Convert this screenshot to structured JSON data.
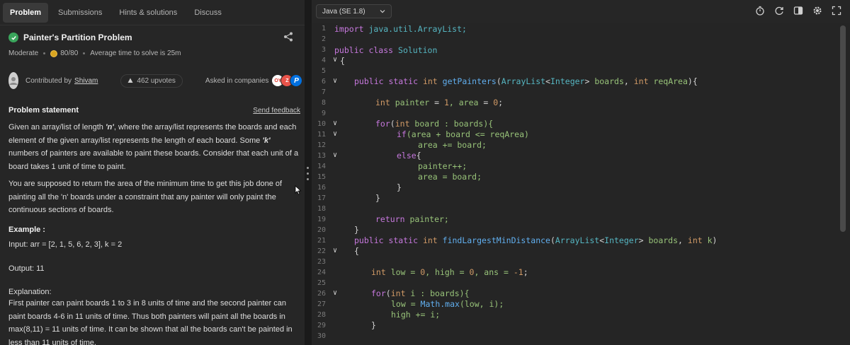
{
  "tabs": [
    "Problem",
    "Submissions",
    "Hints & solutions",
    "Discuss"
  ],
  "problem": {
    "title": "Painter's Partition Problem",
    "difficulty": "Moderate",
    "score": "80/80",
    "avg_time": "Average time to solve is 25m",
    "contributed_prefix": "Contributed by",
    "contributor": "Shivam",
    "upvotes": "462 upvotes",
    "asked_in": "Asked in companies",
    "company_logos": [
      "OY",
      "Z",
      "P"
    ]
  },
  "statement": {
    "title": "Problem statement",
    "feedback": "Send feedback",
    "p1_a": "Given an array/list of length ",
    "p1_n": "'n'",
    "p1_b": ", where the array/list represents the boards and each element of the given array/list represents the length of each board. Some ",
    "p1_k": "'k'",
    "p1_c": " numbers of painters are available to paint these boards. Consider that each unit of a board takes 1 unit of time to paint.",
    "p2": "You are supposed to return the area of the minimum time to get this job done of painting all the 'n' boards under a constraint that any painter will only paint the continuous sections of boards.",
    "example_title": "Example :",
    "example_input": "Input: arr = [2, 1, 5, 6, 2, 3], k = 2",
    "example_output": "Output: 11",
    "explanation_title": "Explanation:",
    "explanation": "First painter can paint boards 1 to 3 in 8 units of time and the second painter can paint boards 4-6 in 11 units of time. Thus both painters will paint all the boards in max(8,11) = 11 units of time. It can be shown that all the boards can't be painted in less than 11 units of time."
  },
  "editor": {
    "language": "Java (SE 1.8)",
    "line_numbers": [
      "1",
      "2",
      "3",
      "4",
      "5",
      "6",
      "7",
      "8",
      "9",
      "10",
      "11",
      "12",
      "13",
      "14",
      "15",
      "16",
      "17",
      "18",
      "19",
      "20",
      "21",
      "22",
      "23",
      "24",
      "25",
      "26",
      "27",
      "28",
      "29",
      "30"
    ],
    "fold_lines": [
      "4",
      "6",
      "10",
      "11",
      "13",
      "22",
      "26"
    ],
    "code": {
      "l1_kw": "import",
      "l1_rest": " java.util.ArrayList;",
      "l3_kw": "public class",
      "l3_rest": " Solution",
      "l4": "{",
      "l6_kw": "public static",
      "l6_type": " int",
      "l6_fn": " getPainters",
      "l6_p1": "(",
      "l6_t1": "ArrayList",
      "l6_p2": "<",
      "l6_t2": "Integer",
      "l6_p3": "> ",
      "l6_v1": "boards",
      "l6_p4": ", ",
      "l6_t3": "int",
      "l6_v2": " reqArea",
      "l6_p5": "){",
      "l8_t": "int",
      "l8_a": " painter",
      "l8_b": " = ",
      "l8_n1": "1",
      "l8_c": ", area",
      "l8_d": " = ",
      "l8_n2": "0",
      "l8_e": ";",
      "l10_kw": "for",
      "l10_a": "(",
      "l10_t": "int",
      "l10_b": " board : boards){",
      "l11_kw": "if",
      "l11_a": "(area + board <= reqArea)",
      "l12": "area += board;",
      "l13_kw": "else",
      "l13_a": "{",
      "l14": "painter++;",
      "l15": "area = board;",
      "l16": "}",
      "l17": "}",
      "l19_kw": "return",
      "l19_a": " painter;",
      "l20": "}",
      "l21_kw": "public static",
      "l21_type": " int",
      "l21_fn": " findLargestMinDistance",
      "l21_p1": "(",
      "l21_t1": "ArrayList",
      "l21_p2": "<",
      "l21_t2": "Integer",
      "l21_p3": "> ",
      "l21_v1": "boards",
      "l21_p4": ", ",
      "l21_t3": "int",
      "l21_v2": " k",
      "l21_p5": ")",
      "l22": "{",
      "l24_t": "int",
      "l24_a": " low = ",
      "l24_n1": "0",
      "l24_b": ", high = ",
      "l24_n2": "0",
      "l24_c": ", ans = ",
      "l24_n3": "-1",
      "l24_d": ";",
      "l26_kw": "for",
      "l26_a": "(",
      "l26_t": "int",
      "l26_b": " i : boards){",
      "l27_a": "low = ",
      "l27_fn": "Math.max",
      "l27_b": "(low, i);",
      "l28": "high += i;",
      "l29": "}"
    }
  }
}
